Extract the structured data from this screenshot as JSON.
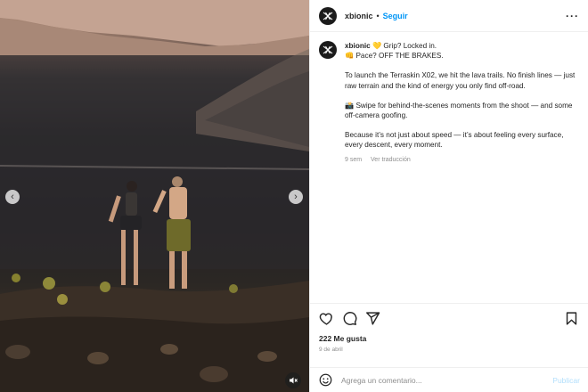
{
  "account": {
    "username": "xbionic",
    "separator": "•",
    "follow_label": "Seguir"
  },
  "caption": {
    "username": "xbionic",
    "line1": "💛 Grip? Locked in.",
    "line2": "👊 Pace? OFF THE BRAKES.",
    "paragraph2": "To launch the Terraskin X02, we hit the lava trails. No finish lines — just raw terrain and the kind of energy you only find off-road.",
    "paragraph3": "📸 Swipe for behind-the-scenes moments from the shoot — and some off-camera goofing.",
    "paragraph4": "Because it’s not just about speed — it’s about feeling every surface, every descent, every moment.",
    "age": "9 sem",
    "translate_label": "Ver traducción"
  },
  "engagement": {
    "likes": "222 Me gusta",
    "date": "9 de abril"
  },
  "comment": {
    "placeholder": "Agrega un comentario...",
    "publish_label": "Publicar"
  },
  "icons": {
    "more": "more-options-icon",
    "like": "heart-icon",
    "comment": "comment-icon",
    "share": "share-icon",
    "save": "bookmark-icon",
    "emoji": "emoji-icon",
    "prev": "chevron-left-icon",
    "next": "chevron-right-icon",
    "mute": "mute-icon"
  },
  "colors": {
    "accent": "#0095f6",
    "publish_disabled": "#b2dffc",
    "muted_text": "#8e8e8e"
  }
}
